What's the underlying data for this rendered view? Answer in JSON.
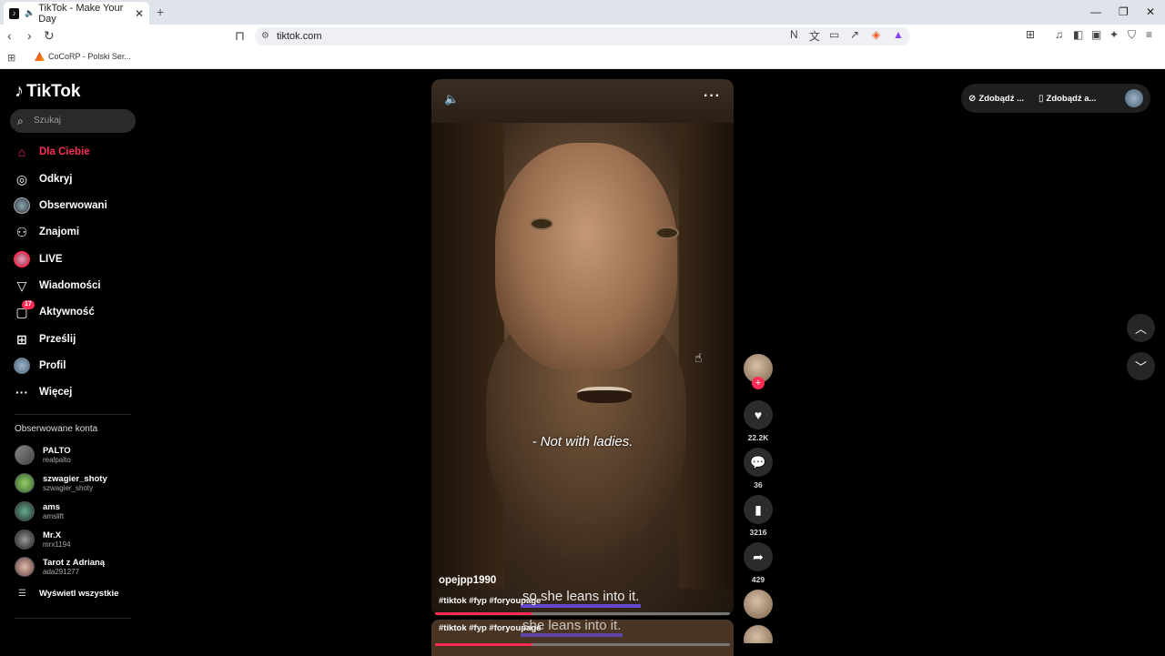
{
  "browser": {
    "tab_title": "TikTok - Make Your Day",
    "url": "tiktok.com",
    "bookmark": "CoCoRP - Polski Ser...",
    "new_tab": "+"
  },
  "app": {
    "logo": "TikTok",
    "search_placeholder": "Szukaj",
    "nav": [
      {
        "label": "Dla Ciebie",
        "icon": "home-icon"
      },
      {
        "label": "Odkryj",
        "icon": "compass-icon"
      },
      {
        "label": "Obserwowani",
        "icon": "following-avatar-icon"
      },
      {
        "label": "Znajomi",
        "icon": "friends-icon"
      },
      {
        "label": "LIVE",
        "icon": "live-icon"
      },
      {
        "label": "Wiadomości",
        "icon": "messages-icon"
      },
      {
        "label": "Aktywność",
        "icon": "activity-icon",
        "badge": "17"
      },
      {
        "label": "Prześlij",
        "icon": "upload-icon"
      },
      {
        "label": "Profil",
        "icon": "profile-avatar-icon"
      },
      {
        "label": "Więcej",
        "icon": "more-icon"
      }
    ],
    "followed_section": "Obserwowane konta",
    "followed": [
      {
        "name": "PALTO",
        "handle": "realpalto"
      },
      {
        "name": "szwagier_shoty",
        "handle": "szwagier_shoty"
      },
      {
        "name": "ams",
        "handle": "amslift"
      },
      {
        "name": "Mr.X",
        "handle": "mrx1194"
      },
      {
        "name": "Tarot z Adrianą",
        "handle": "ada291277"
      }
    ],
    "see_all": "Wyświetl wszystkie",
    "top_buttons": [
      "Zdobądź ...",
      "Zdobądź a..."
    ]
  },
  "video": {
    "caption": "- Not with ladies.",
    "author": "opejpp1990",
    "tags": "#tiktok #fyp #foryoupage",
    "overlay_subtitle": "so she leans into it.",
    "progress": 0.33
  },
  "next_video": {
    "tags": "#tiktok #fyp #foryoupage",
    "overlay_subtitle": "she leans into it.",
    "progress": 0.33
  },
  "actions": {
    "likes": "22.2K",
    "comments": "36",
    "saves": "3216",
    "shares": "429"
  },
  "colors": {
    "accent": "#fe2c55",
    "background": "#000000"
  }
}
